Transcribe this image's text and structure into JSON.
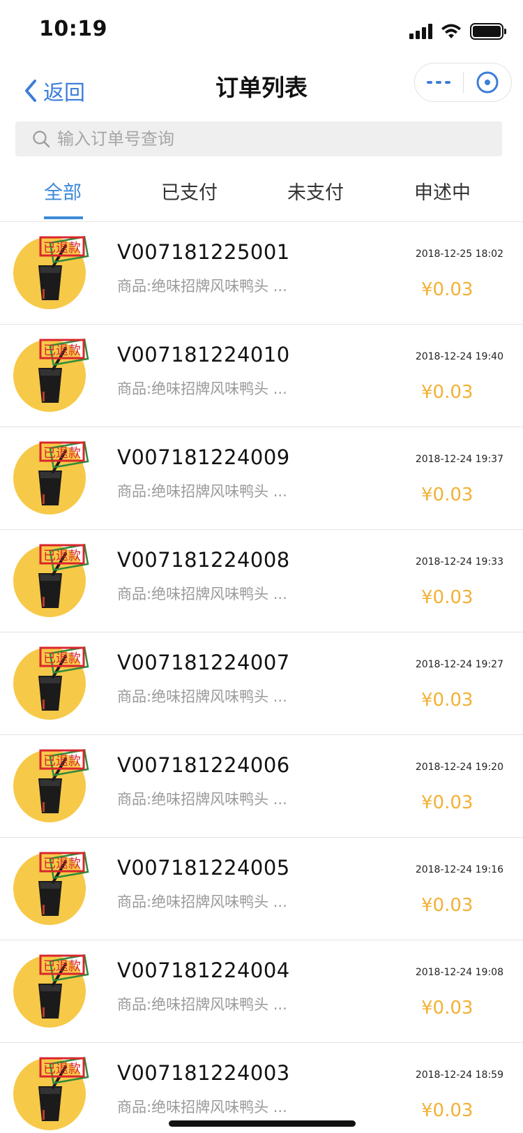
{
  "status_bar": {
    "time": "10:19"
  },
  "nav": {
    "back_label": "返回",
    "title": "订单列表"
  },
  "search": {
    "placeholder": "输入订单号查询"
  },
  "tabs": [
    {
      "label": "全部",
      "active": true
    },
    {
      "label": "已支付",
      "active": false
    },
    {
      "label": "未支付",
      "active": false
    },
    {
      "label": "申述中",
      "active": false
    }
  ],
  "stamp_text": "已退款",
  "orders": [
    {
      "order_no": "V007181225001",
      "goods": "商品:绝味招牌风味鸭头 ...",
      "time": "2018-12-25 18:02",
      "price": "¥0.03"
    },
    {
      "order_no": "V007181224010",
      "goods": "商品:绝味招牌风味鸭头 ...",
      "time": "2018-12-24 19:40",
      "price": "¥0.03"
    },
    {
      "order_no": "V007181224009",
      "goods": "商品:绝味招牌风味鸭头 ...",
      "time": "2018-12-24 19:37",
      "price": "¥0.03"
    },
    {
      "order_no": "V007181224008",
      "goods": "商品:绝味招牌风味鸭头 ...",
      "time": "2018-12-24 19:33",
      "price": "¥0.03"
    },
    {
      "order_no": "V007181224007",
      "goods": "商品:绝味招牌风味鸭头 ...",
      "time": "2018-12-24 19:27",
      "price": "¥0.03"
    },
    {
      "order_no": "V007181224006",
      "goods": "商品:绝味招牌风味鸭头 ...",
      "time": "2018-12-24 19:20",
      "price": "¥0.03"
    },
    {
      "order_no": "V007181224005",
      "goods": "商品:绝味招牌风味鸭头 ...",
      "time": "2018-12-24 19:16",
      "price": "¥0.03"
    },
    {
      "order_no": "V007181224004",
      "goods": "商品:绝味招牌风味鸭头 ...",
      "time": "2018-12-24 19:08",
      "price": "¥0.03"
    },
    {
      "order_no": "V007181224003",
      "goods": "商品:绝味招牌风味鸭头 ...",
      "time": "2018-12-24 18:59",
      "price": "¥0.03"
    }
  ],
  "colors": {
    "accent": "#3d8ad8",
    "price": "#f2b135",
    "thumb_bg": "#f7c948",
    "stamp": "#d9262c"
  }
}
